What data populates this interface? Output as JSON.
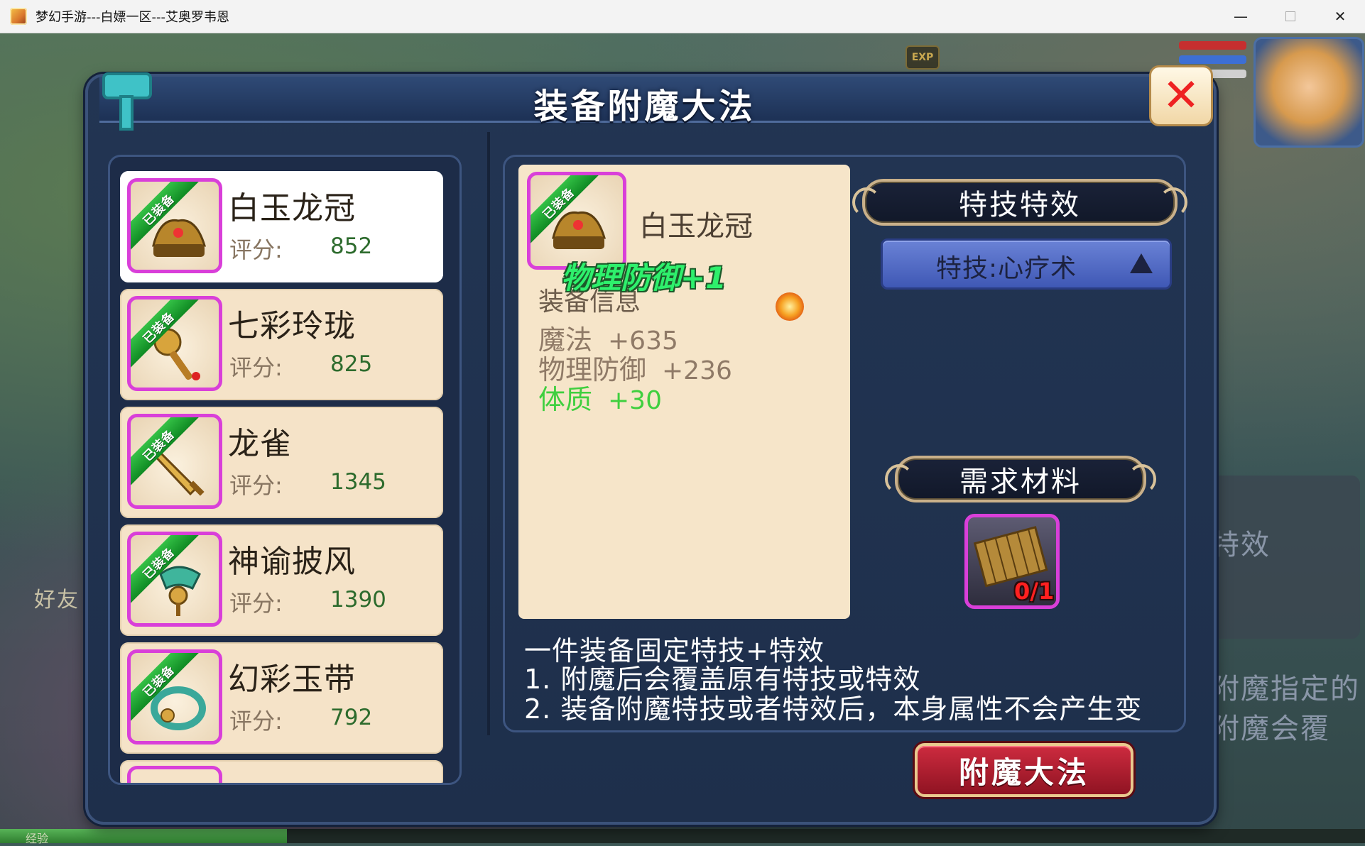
{
  "window": {
    "title": "梦幻手游---白嫖一区---艾奥罗韦恩",
    "minimize": "—",
    "close": "✕"
  },
  "background": {
    "exp_badge": "EXP",
    "exp_bar_label": "经验",
    "exp_bar_fraction": 0.21,
    "right_text_1": "特效",
    "right_text_2": "附魔指定的",
    "right_text_3": "附魔会覆",
    "left_text": "好友"
  },
  "panel": {
    "title": "装备附魔大法",
    "close_icon": "close-x-icon"
  },
  "equipment_list": [
    {
      "tag": "已装备",
      "name": "白玉龙冠",
      "score_label": "评分:",
      "score": "852",
      "icon": "crown-icon",
      "selected": true
    },
    {
      "tag": "已装备",
      "name": "七彩玲珑",
      "score_label": "评分:",
      "score": "825",
      "icon": "mace-icon",
      "selected": false
    },
    {
      "tag": "已装备",
      "name": "龙雀",
      "score_label": "评分:",
      "score": "1345",
      "icon": "sword-icon",
      "selected": false
    },
    {
      "tag": "已装备",
      "name": "神谕披风",
      "score_label": "评分:",
      "score": "1390",
      "icon": "cape-icon",
      "selected": false
    },
    {
      "tag": "已装备",
      "name": "幻彩玉带",
      "score_label": "评分:",
      "score": "792",
      "icon": "belt-icon",
      "selected": false
    }
  ],
  "detail": {
    "tag": "已装备",
    "name": "白玉龙冠",
    "enchant": "物理防御+1",
    "info_heading": "装备信息",
    "stats": [
      {
        "label": "魔法",
        "value": "+635",
        "color": "#8f7a67"
      },
      {
        "label": "物理防御",
        "value": "+236",
        "color": "#8f7a67"
      },
      {
        "label": "体质",
        "value": "+30",
        "color": "#3fcf3f"
      }
    ]
  },
  "skill_effect": {
    "header": "特技特效",
    "select_label": "特技:心疗术"
  },
  "materials": {
    "header": "需求材料",
    "icon": "bamboo-scroll-icon",
    "count": "0/1"
  },
  "description": [
    "一件装备固定特技+特效",
    "1. 附魔后会覆盖原有特技或特效",
    "2. 装备附魔特技或者特效后，本身属性不会产生变"
  ],
  "action_button": "附魔大法"
}
